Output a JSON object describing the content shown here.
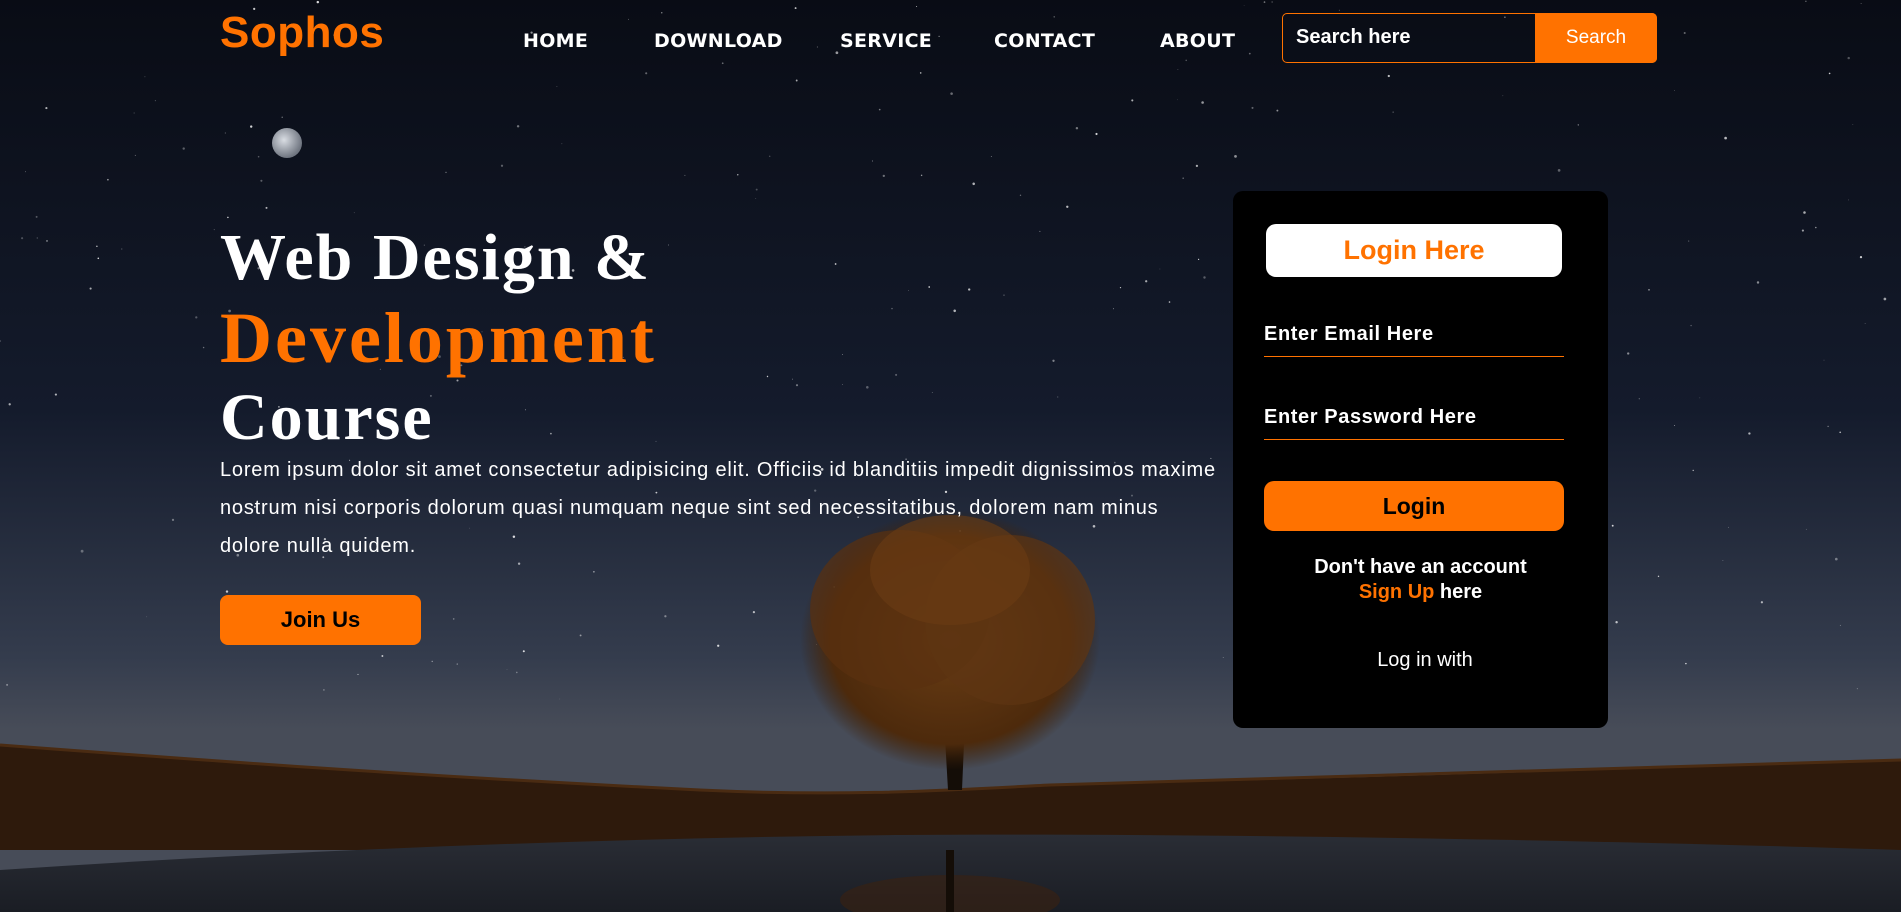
{
  "brand": {
    "logo": "Sophos",
    "accent": "#ff7200"
  },
  "nav": {
    "items": [
      "HOME",
      "DOWNLOAD",
      "SERVICE",
      "CONTACT",
      "ABOUT"
    ]
  },
  "search": {
    "placeholder": "Search here",
    "button_label": "Search"
  },
  "hero": {
    "title_line1": "Web Design &",
    "title_line2": "Development",
    "title_line3": "Course",
    "paragraph": "Lorem ipsum dolor sit amet consectetur adipisicing elit. Officiis id blanditiis impedit dignissimos maxime nostrum nisi corporis dolorum quasi numquam neque sint sed necessitatibus, dolorem nam minus dolore nulla quidem.",
    "join_label": "Join Us"
  },
  "login": {
    "title": "Login Here",
    "email_placeholder": "Enter Email Here",
    "password_placeholder": "Enter Password Here",
    "button_label": "Login",
    "no_account_text": "Don't have an account",
    "signup_link": "Sign Up",
    "signup_suffix": "here",
    "log_in_with": "Log in with"
  }
}
